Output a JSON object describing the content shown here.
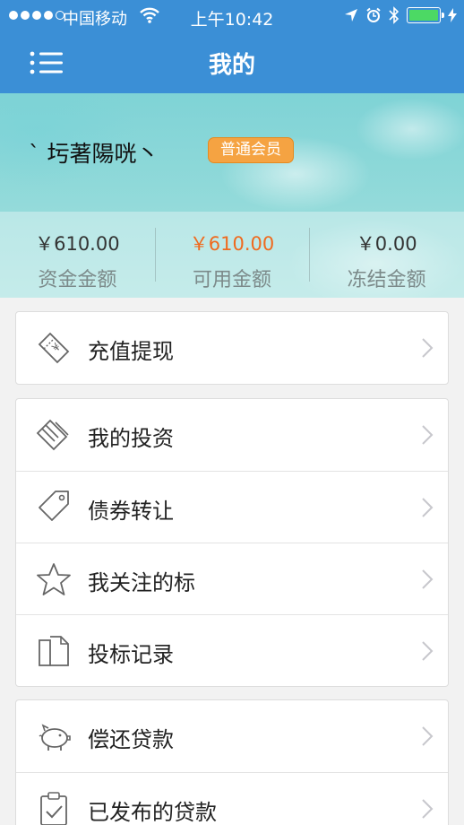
{
  "status_bar": {
    "carrier": "中国移动",
    "time": "上午10:42"
  },
  "nav": {
    "title": "我的",
    "menu_icon": "menu-icon"
  },
  "profile": {
    "username": "ˋ 圬著陽咣丶",
    "badge": "普通会员"
  },
  "stats": [
    {
      "value": "￥610.00",
      "label": "资金金额",
      "highlight": false
    },
    {
      "value": "￥610.00",
      "label": "可用金额",
      "highlight": true
    },
    {
      "value": "￥0.00",
      "label": "冻结金额",
      "highlight": false
    }
  ],
  "groups": [
    [
      {
        "label": "充值提现",
        "icon": "ticket-icon"
      }
    ],
    [
      {
        "label": "我的投资",
        "icon": "card-icon"
      },
      {
        "label": "债券转让",
        "icon": "tag-icon"
      },
      {
        "label": "我关注的标",
        "icon": "star-icon"
      },
      {
        "label": "投标记录",
        "icon": "document-icon"
      }
    ],
    [
      {
        "label": "偿还贷款",
        "icon": "piggy-bank-icon"
      },
      {
        "label": "已发布的贷款",
        "icon": "clipboard-check-icon"
      }
    ]
  ],
  "colors": {
    "nav_blue": "#3b8fd6",
    "accent_orange": "#ef6a1f",
    "badge_orange": "#f5a342"
  }
}
